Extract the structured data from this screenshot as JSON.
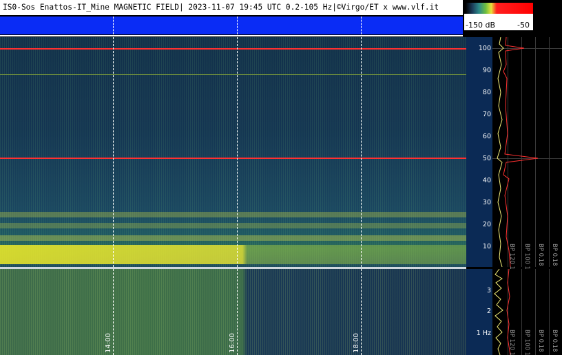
{
  "header": {
    "title": "IS0-Sos Enattos-IT_Mine MAGNETIC FIELD| 2023-11-07 19:45 UTC 0.2-105 Hz|©Virgo/ET x www.vlf.it"
  },
  "colorbar": {
    "min_label": "-150 dB",
    "max_label": "-50"
  },
  "upper_axis": {
    "ticks": [
      "100",
      "90",
      "80",
      "70",
      "60",
      "50",
      "40",
      "30",
      "20",
      "10"
    ]
  },
  "lower_axis": {
    "ticks": [
      "3",
      "2",
      "1 Hz"
    ]
  },
  "time_axis": {
    "labels": [
      "14:00",
      "16:00",
      "18:00"
    ]
  },
  "profile_labels": [
    "BP 120 1",
    "BP 100 1",
    "BP 0.18",
    "BP 0.18",
    "BP 0.18"
  ],
  "colors": {
    "line_50hz": "#ff3030",
    "spectrum_yellow": "#e8e23a",
    "blue_band": "#0a2cf5"
  }
}
